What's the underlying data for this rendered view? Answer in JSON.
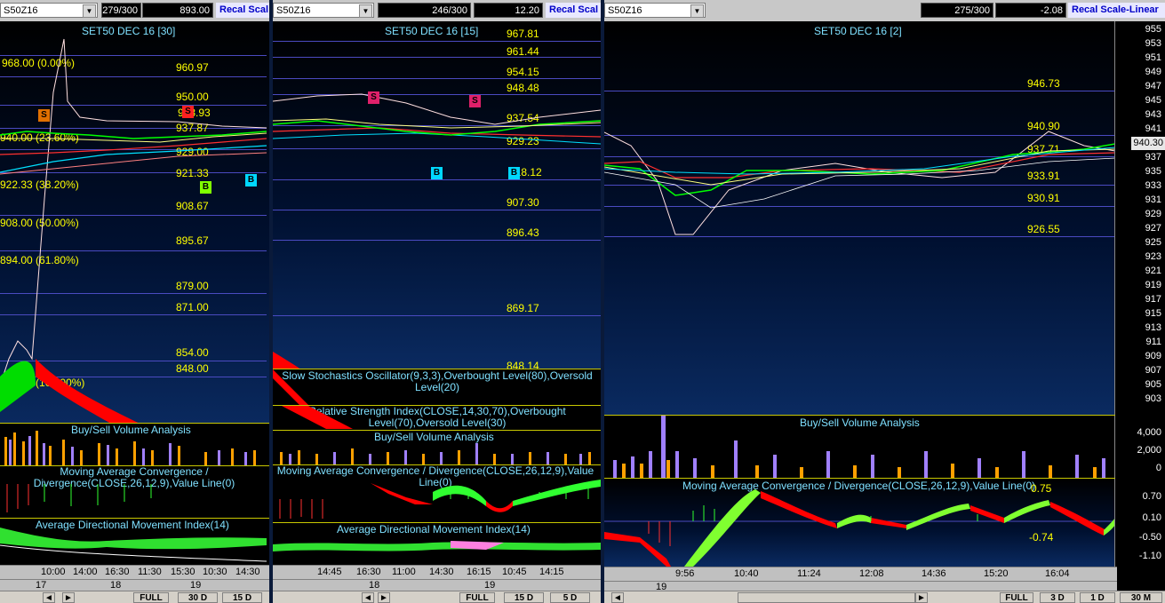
{
  "panels": [
    {
      "symbol": "S50Z16",
      "counter": "279/300",
      "value": "893.00",
      "recal": "Recal Scal",
      "title": "SET50 DEC 16   [30]",
      "levels": [
        "960.97",
        "950.00",
        "943.93",
        "937.87",
        "929.00",
        "921.33",
        "908.67",
        "895.67",
        "879.00",
        "871.00",
        "854.00",
        "848.00"
      ],
      "fibs": [
        "968.00 (0.00%)",
        "940.00 (23.60%)",
        "922.33 (38.20%)",
        "908.00 (50.00%)",
        "894.00 (61.80%)",
        "870.00 (100.00%)"
      ],
      "indicators": [
        "Buy/Sell Volume Analysis",
        "Moving Average Convergence / Divergence(CLOSE,26,12,9),Value Line(0)",
        "Average Directional Movement Index(14)"
      ],
      "xticks": [
        "10:00",
        "14:00",
        "16:30",
        "11:30",
        "15:30",
        "10:30",
        "14:30"
      ],
      "days": [
        "17",
        "18",
        "19"
      ],
      "buttons": [
        "FULL",
        "30 D",
        "15 D"
      ]
    },
    {
      "symbol": "S50Z16",
      "counter": "246/300",
      "value": "12.20",
      "recal": "Recal Scal",
      "title": "SET50 DEC 16   [15]",
      "levels": [
        "967.81",
        "961.44",
        "954.15",
        "948.48",
        "937.54",
        "929.23",
        "918.12",
        "907.30",
        "896.43",
        "869.17",
        "848.14"
      ],
      "indicators": [
        "Slow Stochastics Oscillator(9,3,3),Overbought Level(80),Oversold Level(20)",
        "Relative Strength Index(CLOSE,14,30,70),Overbought Level(70),Oversold Level(30)",
        "Buy/Sell Volume Analysis",
        "Moving Average Convergence / Divergence(CLOSE,26,12,9),Value Line(0)",
        "Average Directional Movement Index(14)"
      ],
      "xticks": [
        "14:45",
        "16:30",
        "11:00",
        "14:30",
        "16:15",
        "10:45",
        "14:15"
      ],
      "days": [
        "18",
        "19"
      ],
      "buttons": [
        "FULL",
        "15 D",
        "5 D"
      ]
    },
    {
      "symbol": "S50Z16",
      "counter": "275/300",
      "value": "-2.08",
      "recal": "Recal Scale-Linear",
      "title": "SET50 DEC 16   [2]",
      "levels": [
        "946.73",
        "940.90",
        "937.71",
        "933.91",
        "930.91",
        "926.55"
      ],
      "yticks": [
        "955",
        "953",
        "951",
        "949",
        "947",
        "945",
        "943",
        "941",
        "939",
        "937",
        "935",
        "933",
        "931",
        "929",
        "927",
        "925",
        "923",
        "921",
        "919",
        "917",
        "915",
        "913",
        "911",
        "909",
        "907",
        "905",
        "903"
      ],
      "price_tag": "940.30",
      "vol_ticks": [
        "4,000",
        "2,000",
        "0"
      ],
      "macd_ticks": [
        "0.70",
        "0.10",
        "-0.50",
        "-1.10"
      ],
      "macd_labels": [
        "0.75",
        "-0.74"
      ],
      "indicators": [
        "Buy/Sell Volume Analysis",
        "Moving Average Convergence / Divergence(CLOSE,26,12,9),Value Line(0)"
      ],
      "xticks": [
        "9:56",
        "10:40",
        "11:24",
        "12:08",
        "14:36",
        "15:20",
        "16:04"
      ],
      "days": [
        "19"
      ],
      "buttons": [
        "FULL",
        "3 D",
        "1 D",
        "30 M"
      ]
    }
  ],
  "markers": {
    "s": "S",
    "b": "B"
  },
  "colors": {
    "level_text": "#ffff00",
    "title_text": "#7fe0ff",
    "bull": "#00ff00",
    "bear": "#ff0000",
    "volume_buy": "#ffa000",
    "volume_sell": "#a080ff"
  }
}
